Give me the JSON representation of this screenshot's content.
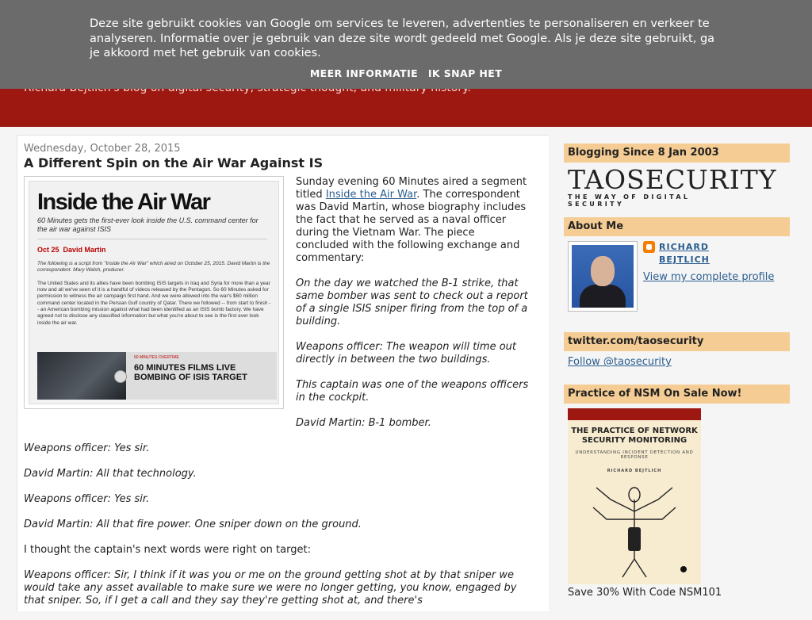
{
  "cookie": {
    "text": "Deze site gebruikt cookies van Google om services te leveren, advertenties te personaliseren en verkeer te analyseren. Informatie over je gebruik van deze site wordt gedeeld met Google. Als je deze site gebruikt, ga je akkoord met het gebruik van cookies.",
    "more_label": "MEER INFORMATIE",
    "ok_label": "IK SNAP HET"
  },
  "header": {
    "description": "Richard Bejtlich's blog on digital security, strategic thought, and military history."
  },
  "post": {
    "date": "Wednesday, October 28, 2015",
    "title": "A Different Spin on the Air War Against IS",
    "intro_before_link": "Sunday evening 60 Minutes aired a segment titled ",
    "link_text": "Inside the Air War",
    "intro_after_link": ". The correspondent was David Martin, whose biography includes the fact that he served as a naval officer during the Vietnam War. The piece concluded with the following exchange and commentary:",
    "quote1": "On the day we watched the B-1 strike, that same bomber was sent to check out a report of a single ISIS sniper firing from the top of a building.",
    "quote2": "Weapons officer: The weapon will time out directly in between the two buildings.",
    "quote3": "This captain was one of the weapons officers in the cockpit.",
    "quote4": "David Martin: B-1 bomber.",
    "quote5": "Weapons officer: Yes sir.",
    "quote6": "David Martin: All that technology.",
    "quote7": "Weapons officer: Yes sir.",
    "quote8": "David Martin: All that fire power. One sniper down on the ground.",
    "plain1": "I thought the captain's next words were right on target:",
    "quote9": "Weapons officer: Sir, I think if it was you or me on the ground getting shot at by that sniper we would take any asset available to make sure we were no longer getting, you know, engaged by that sniper. So, if I get a call and they say they're getting shot at, and there's"
  },
  "post_image": {
    "title": "Inside the Air War",
    "subtitle": "60 Minutes gets the first-ever look inside the U.S. command center for the air war against ISIS",
    "date": "Oct 25",
    "correspondent": "David Martin",
    "intro": "The following is a script from \"Inside the Air War\" which aired on October 25, 2015. David Martin is the correspondent. Mary Walsh, producer.",
    "body": "The United States and its allies have been bombing ISIS targets in Iraq and Syria for more than a year now and all we've seen of it is a handful of videos released by the Pentagon. So 60 Minutes asked for permission to witness the air campaign first hand. And we were allowed into the war's $60 million command center located in the Persian Gulf country of Qatar. There we followed -- from start to finish -- an American bombing mission against what had been identified as an ISIS bomb factory. We have agreed not to disclose any classified information but what you're about to see is the first ever look inside the air war.",
    "video_label": "60 MINUTES OVERTIME",
    "video_title": "60 MINUTES FILMS LIVE BOMBING OF ISIS TARGET"
  },
  "sidebar": {
    "blogging_since": "Blogging Since 8 Jan 2003",
    "logo_main": "TAOSECURITY",
    "logo_sub": "THE WAY OF DIGITAL SECURITY",
    "about_title": "About Me",
    "about_name": "RICHARD BEJTLICH",
    "about_profile_link": "View my complete profile",
    "twitter_title": "twitter.com/taosecurity",
    "twitter_link": "Follow @taosecurity",
    "book_widget_title": "Practice of NSM On Sale Now!",
    "book_title": "THE PRACTICE OF NETWORK SECURITY MONITORING",
    "book_subtitle": "UNDERSTANDING INCIDENT DETECTION AND RESPONSE",
    "book_author": "RICHARD BEJTLICH",
    "book_caption": "Save 30% With Code NSM101"
  },
  "colors": {
    "header_red": "#9e1812",
    "cookie_gray": "#6b6b6b",
    "widget_header": "#f5cd94",
    "link_blue": "#2a5d8f"
  }
}
